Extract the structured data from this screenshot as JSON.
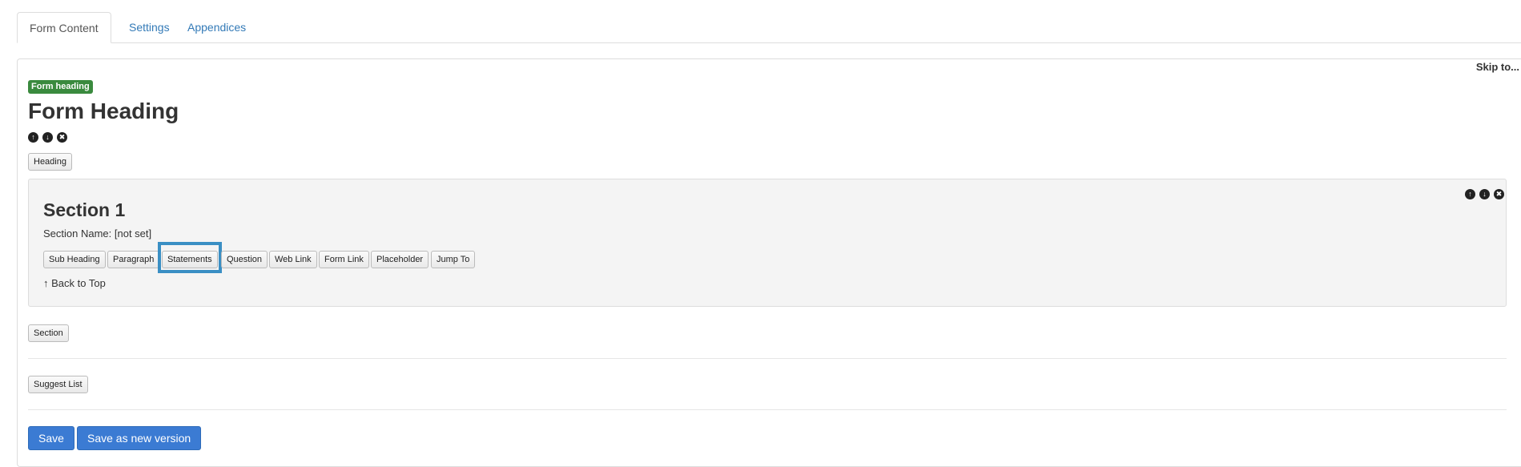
{
  "tabs": [
    {
      "label": "Form Content"
    },
    {
      "label": "Settings"
    },
    {
      "label": "Appendices"
    }
  ],
  "skip_to": "Skip to...",
  "form_heading": {
    "badge": "Form heading",
    "title": "Form Heading",
    "add_button": "Heading"
  },
  "section": {
    "title": "Section 1",
    "name_line": "Section Name: [not set]",
    "buttons": [
      "Sub Heading",
      "Paragraph",
      "Statements",
      "Question",
      "Web Link",
      "Form Link",
      "Placeholder",
      "Jump To"
    ],
    "back_to_top": "Back to Top"
  },
  "add_section_button": "Section",
  "suggest_list_button": "Suggest List",
  "actions": {
    "save": "Save",
    "save_new_version": "Save as new version"
  },
  "icons": [
    "arrow-up-icon",
    "arrow-down-icon",
    "remove-icon"
  ],
  "colors": {
    "badge_green": "#3a8a3e",
    "primary_blue": "#3b7bd3",
    "highlight_blue": "#3a8fc4",
    "link_blue": "#337ab7"
  }
}
